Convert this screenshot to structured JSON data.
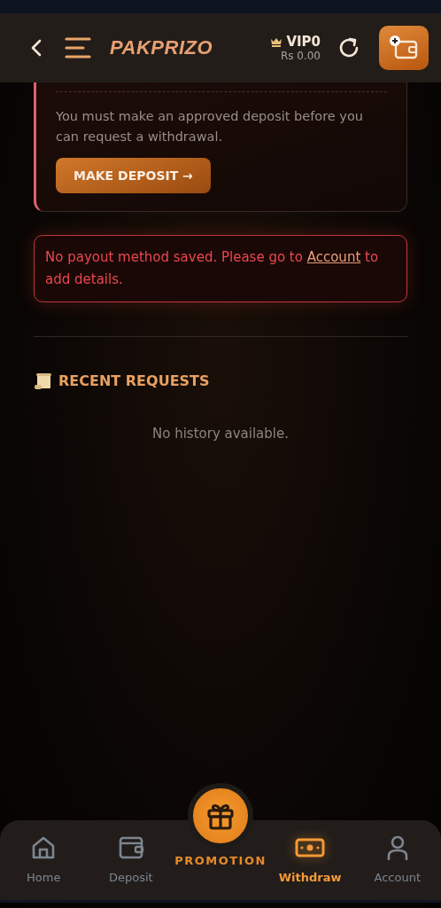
{
  "header": {
    "logo": "PAKPRIZO",
    "vip": "VIP0",
    "balance": "Rs 0.00"
  },
  "deposit_notice": {
    "message": "You must make an approved deposit before you can request a withdrawal.",
    "button": "MAKE DEPOSIT →"
  },
  "payout_alert": {
    "before": "No payout method saved. Please go to ",
    "link": "Account",
    "after": " to add details."
  },
  "recent_requests": {
    "heading": "RECENT REQUESTS",
    "empty": "No history available."
  },
  "bottom_nav": [
    {
      "label": "Home",
      "kind": "tab",
      "selected": false
    },
    {
      "label": "Deposit",
      "kind": "tab",
      "selected": false
    },
    {
      "label": "PROMOTION",
      "kind": "promo",
      "selected": false
    },
    {
      "label": "Withdraw",
      "kind": "tab",
      "selected": true
    },
    {
      "label": "Account",
      "kind": "tab",
      "selected": false
    }
  ]
}
